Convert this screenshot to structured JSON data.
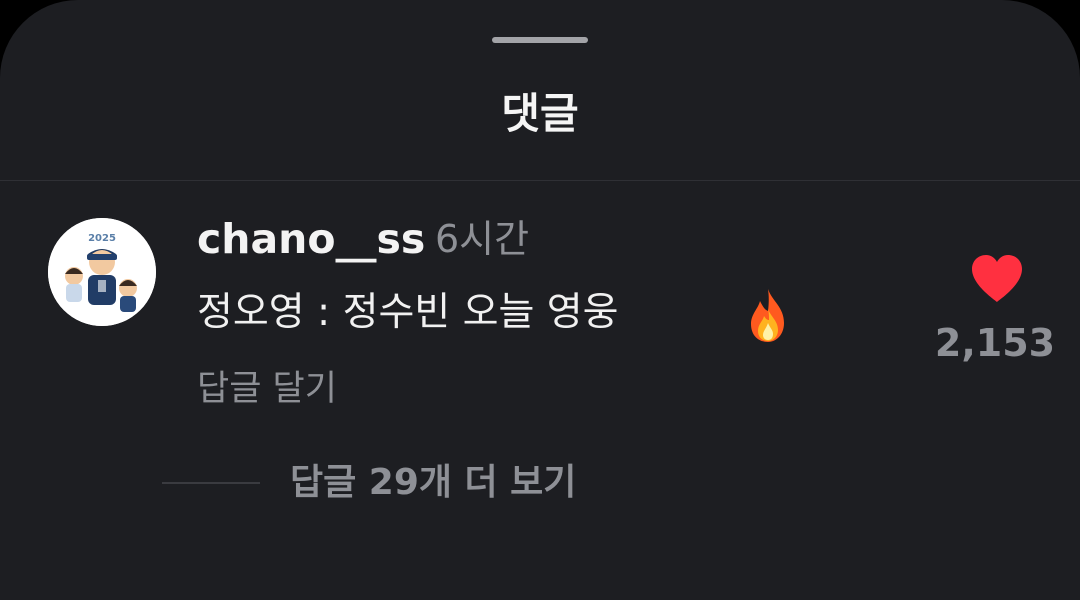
{
  "sheet": {
    "title": "댓글"
  },
  "comment": {
    "avatar_badge": "2025",
    "username": "chano__ss",
    "timestamp": "6시간",
    "text": "정오영 : 정수빈 오늘 영웅",
    "emoji": "fire-emoji",
    "reply_label": "답글 달기",
    "like_count": "2,153",
    "like_icon": "heart-icon",
    "view_replies_label": "답글 29개 더 보기"
  },
  "colors": {
    "background": "#1d1e22",
    "primary_text": "#f3f3f3",
    "secondary_text": "#8e9096",
    "like": "#ff3040"
  }
}
